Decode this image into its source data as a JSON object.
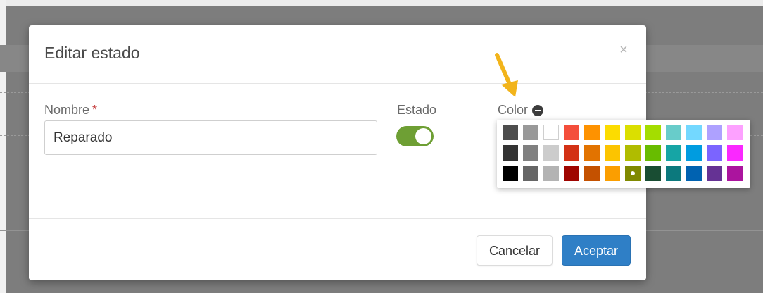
{
  "modal": {
    "title": "Editar estado",
    "close_label": "×",
    "name_label": "Nombre",
    "required_mark": "*",
    "name_value": "Reparado",
    "state_label": "Estado",
    "state_enabled": true,
    "color_label": "Color",
    "cancel_label": "Cancelar",
    "accept_label": "Aceptar"
  },
  "palette": {
    "selected": "#808000",
    "rows": [
      [
        "#4d4d4d",
        "#999999",
        "#ffffff",
        "#f44e3b",
        "#fe9200",
        "#fcdc00",
        "#dbdf00",
        "#a4dd00",
        "#68ccca",
        "#73d8ff",
        "#aea1ff",
        "#fda1ff"
      ],
      [
        "#333333",
        "#808080",
        "#cccccc",
        "#d33115",
        "#e27300",
        "#fcc400",
        "#b0bc00",
        "#68bc00",
        "#16a5a5",
        "#009ce0",
        "#7b64ff",
        "#fa28ff"
      ],
      [
        "#000000",
        "#666666",
        "#b3b3b3",
        "#9f0500",
        "#c45100",
        "#fb9e00",
        "#808900",
        "#194d33",
        "#0c797d",
        "#0062b1",
        "#653294",
        "#ab149e"
      ]
    ]
  },
  "annotation": {
    "arrow_color": "#f2b41b"
  }
}
